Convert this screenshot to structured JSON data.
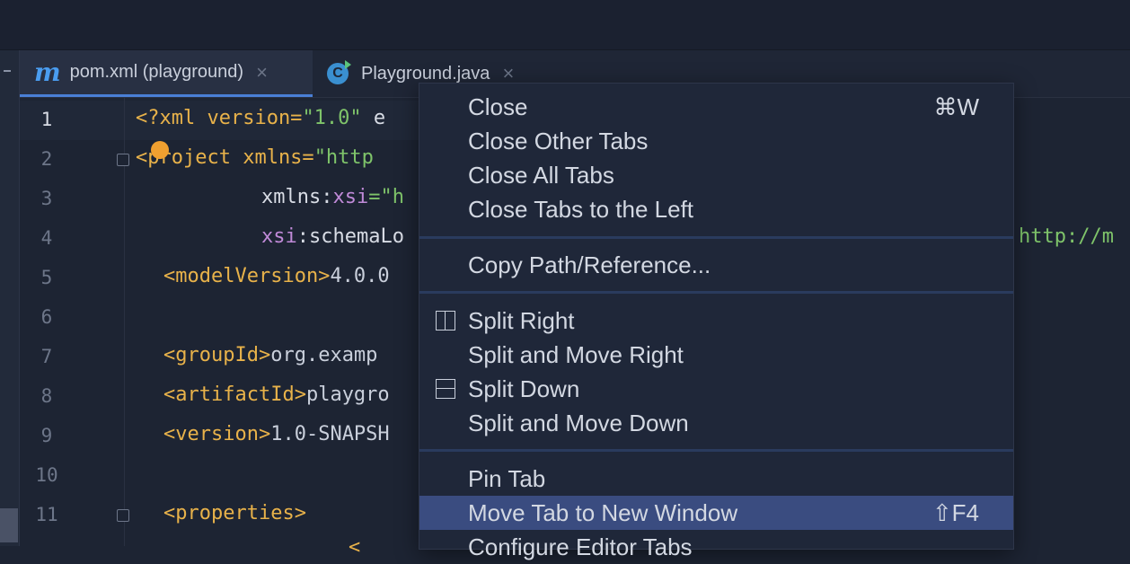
{
  "tabs": [
    {
      "icon": "maven-icon",
      "glyph": "m",
      "label": "pom.xml (playground)",
      "active": true
    },
    {
      "icon": "java-class-icon",
      "glyph": "C",
      "label": "Playground.java",
      "active": false
    }
  ],
  "close_glyph": "×",
  "line_numbers": [
    "1",
    "2",
    "3",
    "4",
    "5",
    "6",
    "7",
    "8",
    "9",
    "10",
    "11"
  ],
  "code": {
    "l1_a": "<?xml version=",
    "l1_b": "\"1.0\"",
    "l1_c": " e",
    "l2_a": "<project xmlns=",
    "l2_b": "\"http",
    "l3_a": "xmlns:",
    "l3_b": "xsi",
    "l3_c": "=\"h",
    "l4_a": "xsi",
    "l4_b": ":schemaLo",
    "l4_right": "http://m",
    "l5_a": "<modelVersion>",
    "l5_b": "4.0.0",
    "l7_a": "<groupId>",
    "l7_b": "org.examp",
    "l8_a": "<artifactId>",
    "l8_b": "playgro",
    "l9_a": "<version>",
    "l9_b": "1.0-SNAPSH",
    "l11_a": "<properties>",
    "l12_a": "<"
  },
  "context_menu": {
    "items": [
      {
        "label": "Close",
        "shortcut": "⌘W"
      },
      {
        "label": "Close Other Tabs"
      },
      {
        "label": "Close All Tabs"
      },
      {
        "label": "Close Tabs to the Left"
      },
      {
        "label": "Copy Path/Reference..."
      },
      {
        "label": "Split Right",
        "icon": "split-vertical-icon"
      },
      {
        "label": "Split and Move Right"
      },
      {
        "label": "Split Down",
        "icon": "split-horizontal-icon"
      },
      {
        "label": "Split and Move Down"
      },
      {
        "label": "Pin Tab"
      },
      {
        "label": "Move Tab to New Window",
        "shortcut": "⇧F4",
        "selected": true
      },
      {
        "label": "Configure Editor Tabs"
      }
    ]
  },
  "colors": {
    "background": "#1d2433",
    "xml_tag": "#e8b24a",
    "xml_value": "#7fc46a",
    "xml_namespace": "#c08ad8",
    "menu_selection": "#3a4c80",
    "active_tab_underline": "#4a7fd6"
  }
}
